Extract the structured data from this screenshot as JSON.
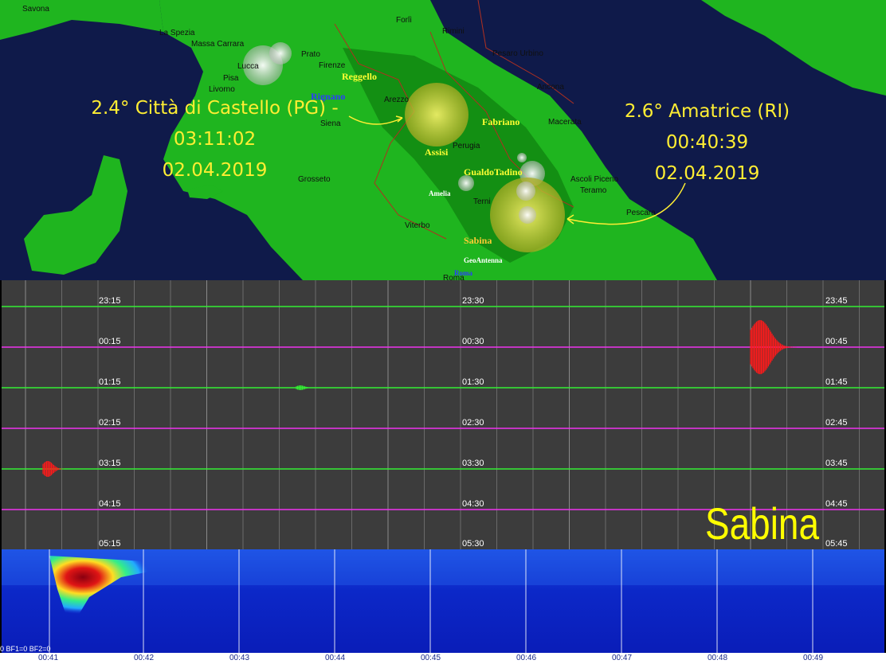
{
  "map": {
    "cities": [
      "Savona",
      "La Spezia",
      "Massa Carrara",
      "Lucca",
      "Prato",
      "Pisa",
      "Livorno",
      "Firenze",
      "Forlì",
      "Rimini",
      "Pesaro Urbino",
      "Ancona",
      "Arezzo",
      "Siena",
      "Macerata",
      "Perugia",
      "Grosseto",
      "Ascoli Piceno",
      "Teramo",
      "Terni",
      "Viterbo",
      "Pescara",
      "Roma"
    ],
    "regions": {
      "reggello": "Reggello",
      "romano": "Rignano",
      "fabriano": "Fabriano",
      "assisi": "Assisi",
      "gualdo": "GualdoTadino",
      "amelia": "Amelia",
      "sabina": "Sabina",
      "geoantenna": "GeoAntenna",
      "roma": "Roma"
    },
    "quake_left": {
      "line1": "2.4° Città  di Castello (PG) -",
      "line2": "03:11:02",
      "line3": "02.04.2019"
    },
    "quake_right": {
      "line1": "2.6° Amatrice (RI)",
      "line2": "00:40:39",
      "line3": "02.04.2019"
    },
    "colors": {
      "sea": "#0f1a4a",
      "land": "#1fb51f",
      "highland": "#0f7d0f",
      "borders": "#b03020",
      "label": "#ffee33"
    }
  },
  "helicorder": {
    "left_times": [
      "23:15",
      "00:15",
      "01:15",
      "02:15",
      "03:15",
      "04:15",
      "05:15"
    ],
    "mid_times": [
      "23:30",
      "00:30",
      "01:30",
      "02:30",
      "03:30",
      "04:30",
      "05:30"
    ],
    "right_times": [
      "23:45",
      "00:45",
      "01:45",
      "02:45",
      "03:45",
      "04:45",
      "05:45"
    ],
    "trace_colors": [
      "#33ee33",
      "#ee33ee"
    ],
    "event_color": "#ff1a1a",
    "station": "Sabina"
  },
  "spectrogram": {
    "filter_text": "0 BF1=0 BF2=0",
    "axis_labels": [
      "00:41",
      "00:42",
      "00:43",
      "00:44",
      "00:45",
      "00:46",
      "00:47",
      "00:48",
      "00:49"
    ]
  }
}
